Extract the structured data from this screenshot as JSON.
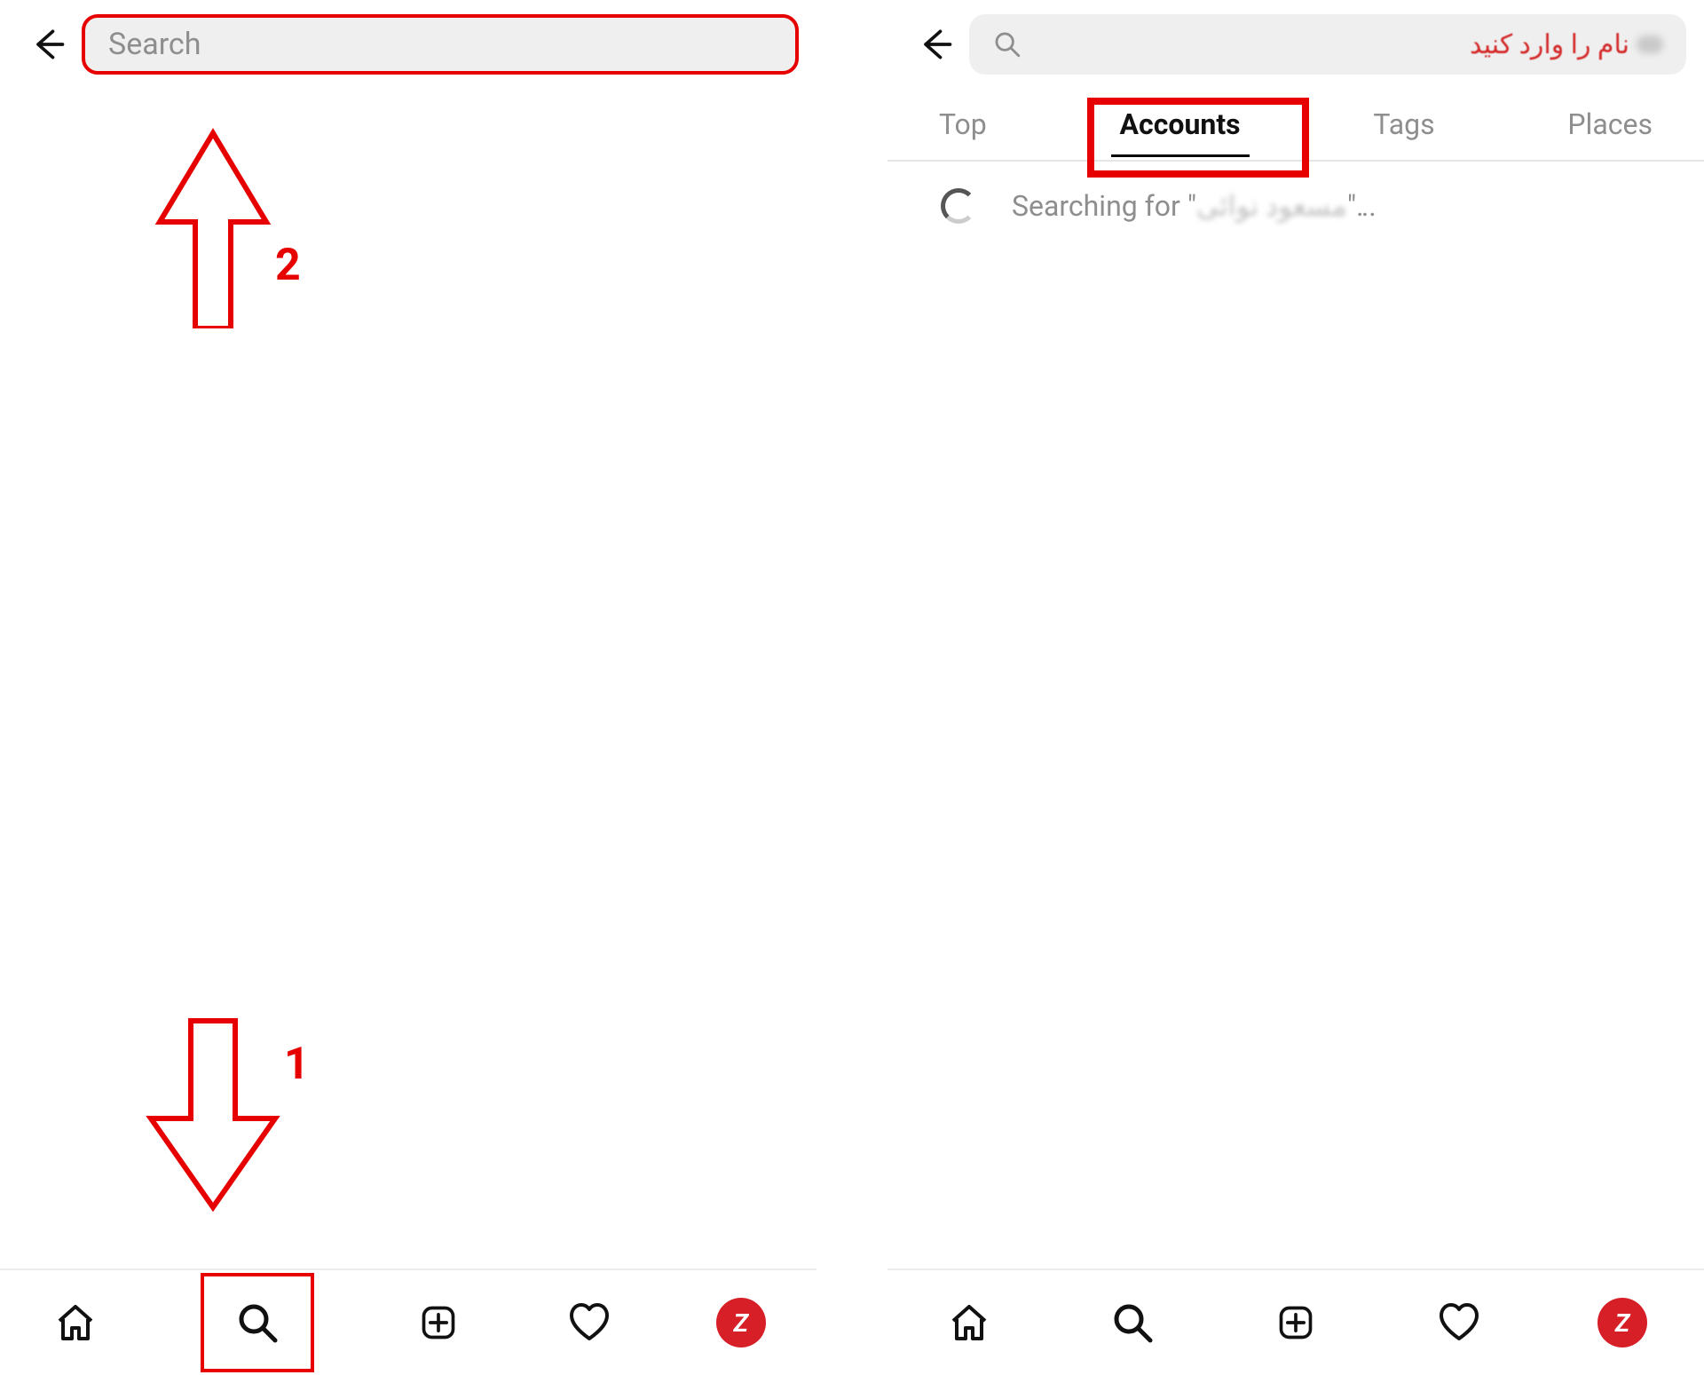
{
  "left": {
    "search_placeholder": "Search",
    "annotations": {
      "arrow_up_label": "2",
      "arrow_down_label": "1"
    },
    "nav_profile_letter": "Z"
  },
  "right": {
    "search_placeholder_fa": "نام را وارد کنید",
    "tabs": {
      "top": "Top",
      "accounts": "Accounts",
      "tags": "Tags",
      "places": "Places"
    },
    "searching_prefix": "Searching for \"",
    "searching_blurred": "مسعود نوائی",
    "searching_suffix": "\"...",
    "nav_profile_letter": "Z"
  }
}
